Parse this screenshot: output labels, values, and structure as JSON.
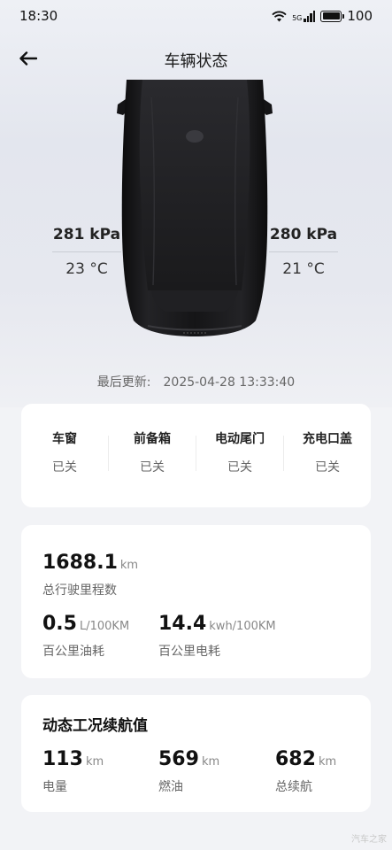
{
  "status_bar": {
    "time": "18:30",
    "signal": "5G",
    "battery": "100"
  },
  "header": {
    "title": "车辆状态",
    "back_icon": "arrow-left-icon"
  },
  "tires": {
    "front_left": {
      "pressure": "281 kPa",
      "temperature": "23 °C"
    },
    "front_right": {
      "pressure": "280 kPa",
      "temperature": "21 °C"
    }
  },
  "last_update": {
    "label": "最后更新:",
    "value": "2025-04-28 13:33:40"
  },
  "status_items": [
    {
      "name": "车窗",
      "value": "已关"
    },
    {
      "name": "前备箱",
      "value": "已关"
    },
    {
      "name": "电动尾门",
      "value": "已关"
    },
    {
      "name": "充电口盖",
      "value": "已关"
    }
  ],
  "metrics": {
    "odometer": {
      "value": "1688.1",
      "unit": "km",
      "label": "总行驶里程数"
    },
    "fuel_consumption": {
      "value": "0.5",
      "unit": "L/100KM",
      "label": "百公里油耗"
    },
    "power_consumption": {
      "value": "14.4",
      "unit": "kwh/100KM",
      "label": "百公里电耗"
    }
  },
  "range": {
    "title": "动态工况续航值",
    "items": [
      {
        "value": "113",
        "unit": "km",
        "label": "电量"
      },
      {
        "value": "569",
        "unit": "km",
        "label": "燃油"
      },
      {
        "value": "682",
        "unit": "km",
        "label": "总续航"
      }
    ]
  },
  "watermark": "汽车之家",
  "colors": {
    "background": "#f2f3f6",
    "card": "#ffffff",
    "car_body": "#151517"
  }
}
